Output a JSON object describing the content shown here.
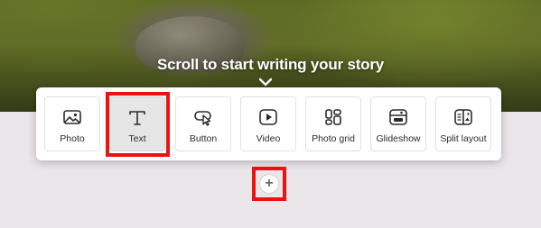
{
  "hero": {
    "title": "Scroll to start writing your story"
  },
  "insert_menu": {
    "items": [
      {
        "label": "Photo",
        "icon": "photo-icon"
      },
      {
        "label": "Text",
        "icon": "text-icon"
      },
      {
        "label": "Button",
        "icon": "button-cursor-icon"
      },
      {
        "label": "Video",
        "icon": "video-icon"
      },
      {
        "label": "Photo grid",
        "icon": "photo-grid-icon"
      },
      {
        "label": "Glideshow",
        "icon": "glideshow-icon"
      },
      {
        "label": "Split layout",
        "icon": "split-layout-icon"
      }
    ],
    "selected": "Text"
  },
  "add_button": {
    "symbol": "+"
  },
  "colors": {
    "highlight": "#ee1111",
    "icon": "#2c2c2c",
    "page_background": "#eae6ea"
  }
}
